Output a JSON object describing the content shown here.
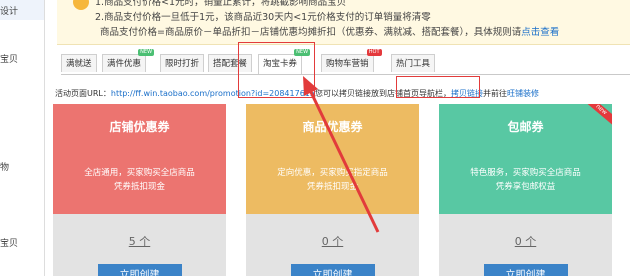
{
  "left_nav": {
    "fragments": [
      "设计",
      "宝贝",
      "物",
      "宝贝"
    ]
  },
  "notice": {
    "line1": "1.商品支付价格<1元时，销量止累计，将跳截影响商品宝贝",
    "line2": "2.商品支付价格一旦低于1元，该商品近30天内<1元价格支付的订单销量将清零",
    "line3": "商品支付价格=商品原价－单品折扣－店铺优惠均摊折扣（优惠券、满就减、搭配套餐），具体规则请",
    "link": "点击查看"
  },
  "tabs": [
    {
      "label": "满就送",
      "badge": ""
    },
    {
      "label": "满件优惠",
      "badge": "NEW"
    },
    {
      "label": "限时打折",
      "badge": ""
    },
    {
      "label": "搭配套餐",
      "badge": ""
    },
    {
      "label": "淘宝卡券",
      "badge": "NEW"
    },
    {
      "label": "购物车营销",
      "badge": "HOT"
    },
    {
      "label": "热门工具",
      "badge": ""
    }
  ],
  "active_tab": "淘宝卡券",
  "url_bar": {
    "label": "活动页面URL：",
    "url": "http://ff.win.taobao.com/promotion?id=208417615",
    "suffix": "您可以拷贝链接放到店铺首页导航栏，",
    "link1": "拷贝链接",
    "mid": "并前往",
    "link2": "旺铺装修"
  },
  "cards": [
    {
      "title": "店铺优惠券",
      "desc1": "全店通用，买家购买全店商品",
      "desc2": "凭券抵扣现金",
      "count": "5 个",
      "button": "立即创建",
      "color": "#ec7470",
      "ribbon": ""
    },
    {
      "title": "商品优惠券",
      "desc1": "定向优惠，买家购买指定商品",
      "desc2": "凭券抵扣现金",
      "count": "0 个",
      "button": "立即创建",
      "color": "#edbb62",
      "ribbon": ""
    },
    {
      "title": "包邮券",
      "desc1": "特色服务，买家购买全店商品",
      "desc2": "凭券享包邮权益",
      "count": "0 个",
      "button": "立即创建",
      "color": "#58c8a3",
      "ribbon": "new"
    }
  ]
}
